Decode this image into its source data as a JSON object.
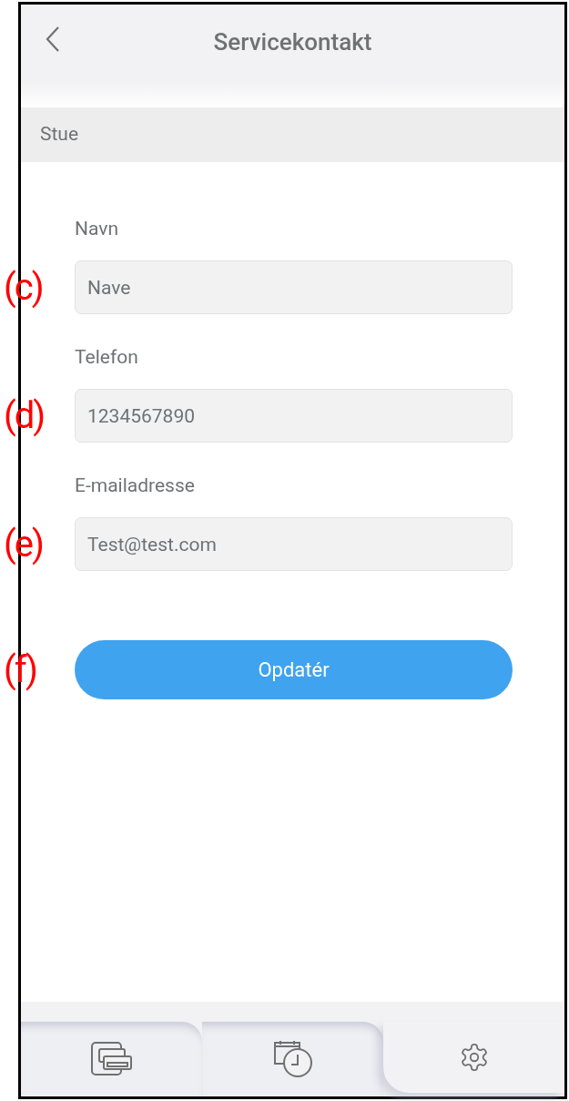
{
  "header": {
    "title": "Servicekontakt"
  },
  "section": {
    "title": "Stue"
  },
  "fields": [
    {
      "label": "Navn",
      "value": "Nave",
      "callout": "(c)"
    },
    {
      "label": "Telefon",
      "value": "1234567890",
      "callout": "(d)"
    },
    {
      "label": "E-mailadresse",
      "value": "Test@test.com",
      "callout": "(e)"
    }
  ],
  "button": {
    "label": "Opdatér",
    "callout": "(f)"
  },
  "tabs": [
    {
      "kind": "devices",
      "selected": false
    },
    {
      "kind": "schedule",
      "selected": false
    },
    {
      "kind": "settings",
      "selected": true
    }
  ]
}
